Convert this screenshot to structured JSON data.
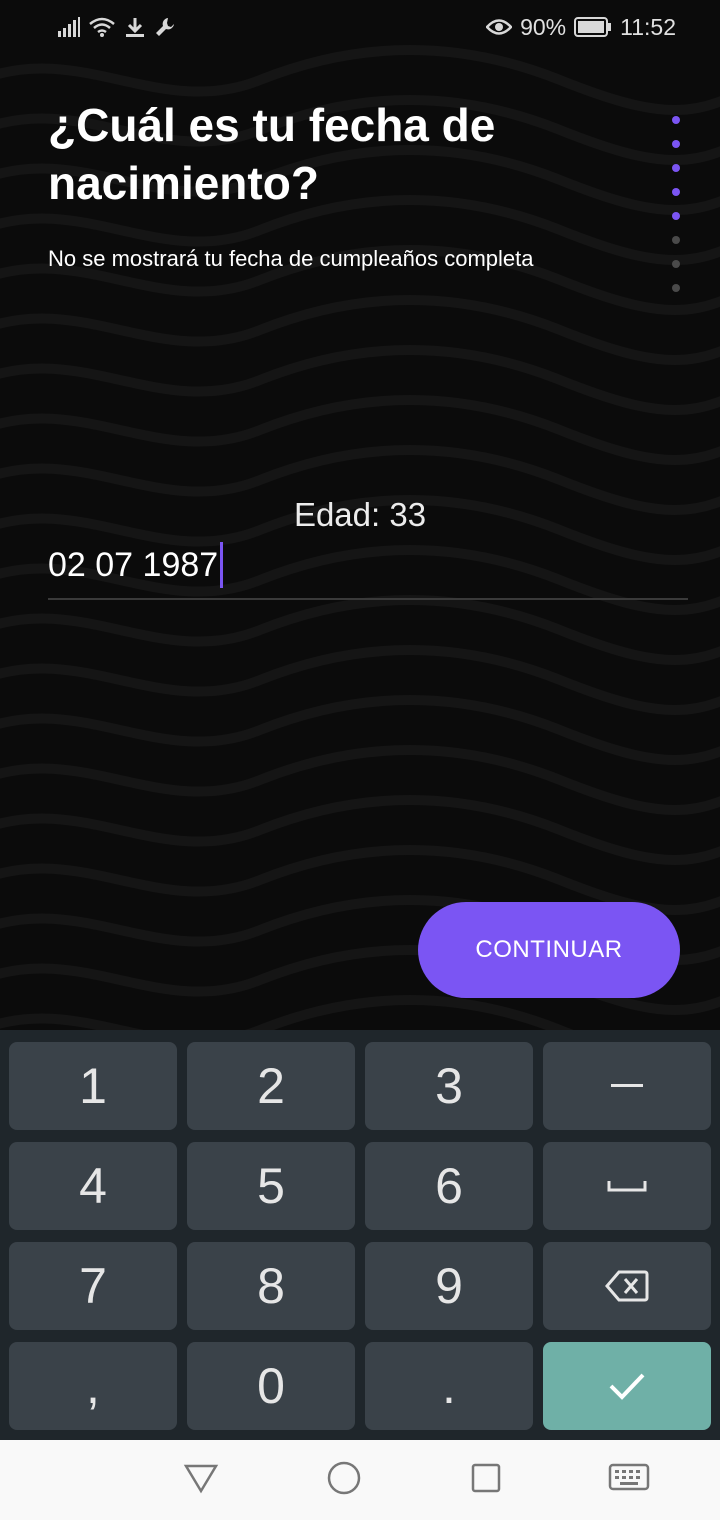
{
  "status_bar": {
    "battery_percent": "90%",
    "time": "11:52",
    "icons": [
      "signal-icon",
      "wifi-icon",
      "download-icon",
      "wrench-icon",
      "eye-icon",
      "battery-icon"
    ]
  },
  "header": {
    "title": "¿Cuál es tu fecha de nacimiento?",
    "subtitle": "No se mostrará tu fecha de cumpleaños completa"
  },
  "progress": {
    "total_steps": 8,
    "active_steps": 5,
    "active_color": "#7b55f3",
    "inactive_color": "#4a4a4a"
  },
  "form": {
    "age_label": "Edad: 33",
    "date_value": "02 07 1987"
  },
  "actions": {
    "continue_label": "CONTINUAR"
  },
  "keyboard": {
    "keys": [
      "1",
      "2",
      "3",
      "–",
      "4",
      "5",
      "6",
      "␣",
      "7",
      "8",
      "9",
      "⌫",
      ",",
      "0",
      ".",
      "✓"
    ]
  },
  "colors": {
    "accent": "#7b55f3",
    "background": "#0b0b0b",
    "keyboard_bg": "#1f262b",
    "key_bg": "#3a4249",
    "enter_key": "#6fb0a7"
  }
}
